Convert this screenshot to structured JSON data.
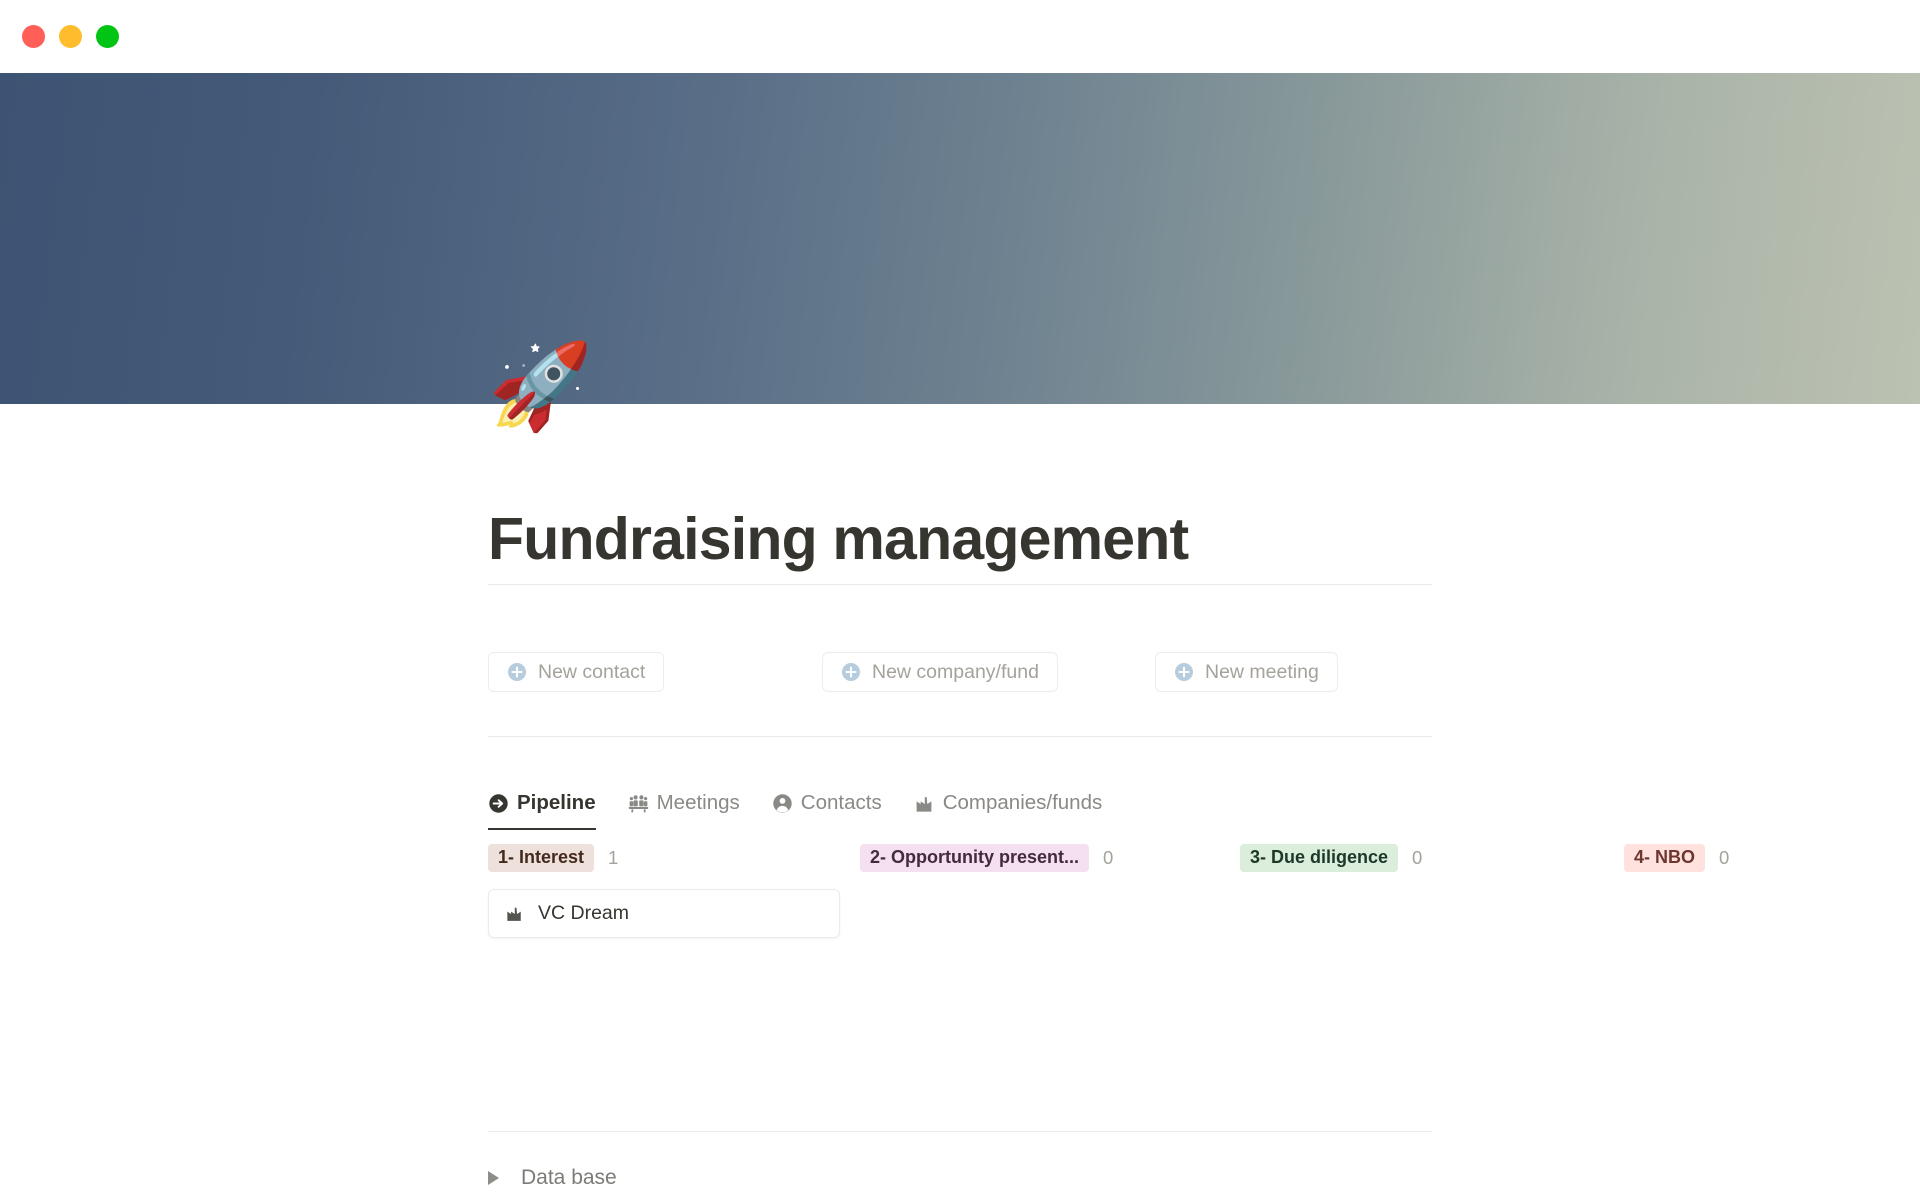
{
  "window": {
    "controls": [
      {
        "name": "close",
        "color": "#ff5f57"
      },
      {
        "name": "minimize",
        "color": "#ffbd2e"
      },
      {
        "name": "maximize",
        "color": "#00c514"
      }
    ]
  },
  "cover": {
    "gradient_from": "#3d5373",
    "gradient_to": "#bcc2b2"
  },
  "page": {
    "icon": "🚀",
    "title": "Fundraising management"
  },
  "actions": [
    {
      "label": "New contact",
      "icon": "plus-circle-icon"
    },
    {
      "label": "New company/fund",
      "icon": "plus-circle-icon"
    },
    {
      "label": "New meeting",
      "icon": "plus-circle-icon"
    }
  ],
  "tabs": [
    {
      "label": "Pipeline",
      "icon": "arrow-right-circle-icon",
      "active": true
    },
    {
      "label": "Meetings",
      "icon": "people-group-icon",
      "active": false
    },
    {
      "label": "Contacts",
      "icon": "person-circle-icon",
      "active": false
    },
    {
      "label": "Companies/funds",
      "icon": "factory-icon",
      "active": false
    }
  ],
  "board": {
    "columns": [
      {
        "label": "1- Interest",
        "count": "1",
        "bg": "#eee0da",
        "fg": "#442a1e",
        "cards": [
          {
            "label": "VC Dream",
            "icon": "factory-icon"
          }
        ]
      },
      {
        "label": "2- Opportunity present...",
        "count": "0",
        "bg": "#f5e0f0",
        "fg": "#442a3d",
        "cards": []
      },
      {
        "label": "3- Due diligence",
        "count": "0",
        "bg": "#dbeddb",
        "fg": "#1c3829",
        "cards": []
      },
      {
        "label": "4- NBO",
        "count": "0",
        "bg": "#ffe2dd",
        "fg": "#6e3630",
        "cards": []
      }
    ]
  },
  "toggle": {
    "label": "Data base"
  }
}
